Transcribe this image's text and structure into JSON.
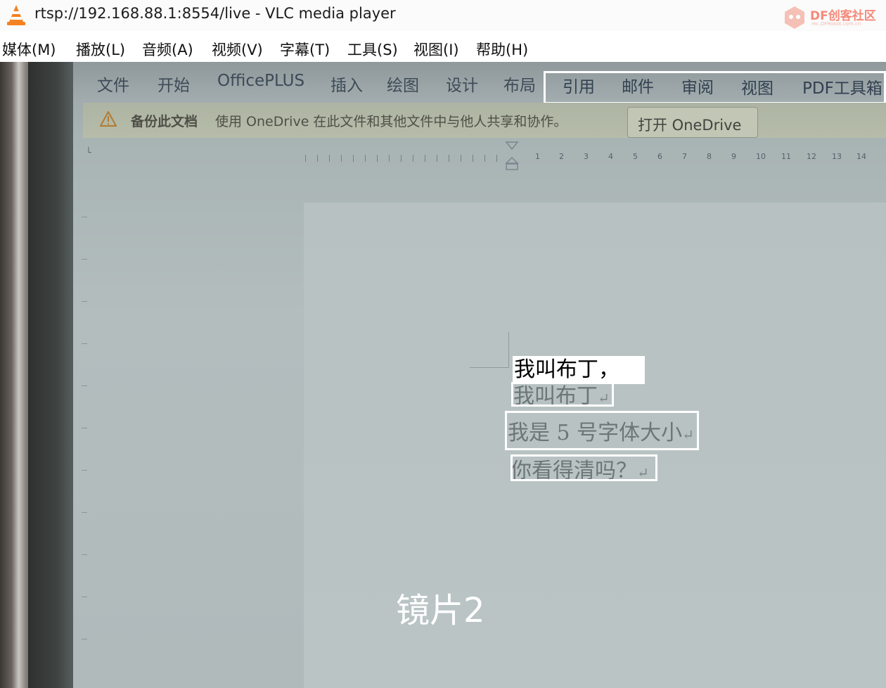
{
  "window": {
    "title": "rtsp://192.168.88.1:8554/live - VLC media player",
    "watermark_text": "DF创客社区",
    "watermark_sub": "mc.DFRobot.com.cn"
  },
  "menubar": {
    "items": [
      "媒体(M)",
      "播放(L)",
      "音频(A)",
      "视频(V)",
      "字幕(T)",
      "工具(S)",
      "视图(I)",
      "帮助(H)"
    ]
  },
  "video": {
    "ribbon_tabs": [
      "文件",
      "开始",
      "OfficePLUS",
      "插入",
      "绘图",
      "设计",
      "布局",
      "引用",
      "邮件",
      "审阅",
      "视图",
      "PDF工具箱"
    ],
    "infobar": {
      "bold": "备份此文档",
      "message": "使用 OneDrive 在此文件和其他文件中与他人共享和协作。",
      "button": "打开 OneDrive"
    },
    "ruler_numbers": [
      "1",
      "2",
      "3",
      "4",
      "5",
      "6",
      "7",
      "8",
      "9",
      "10",
      "11",
      "12",
      "13",
      "14"
    ],
    "document_lines": [
      "我叫布丁",
      "我是 5 号字体大小",
      "你看得清吗？"
    ],
    "return_mark": "↵",
    "ocr_label": "我叫布丁，",
    "caption": "镜片2"
  }
}
